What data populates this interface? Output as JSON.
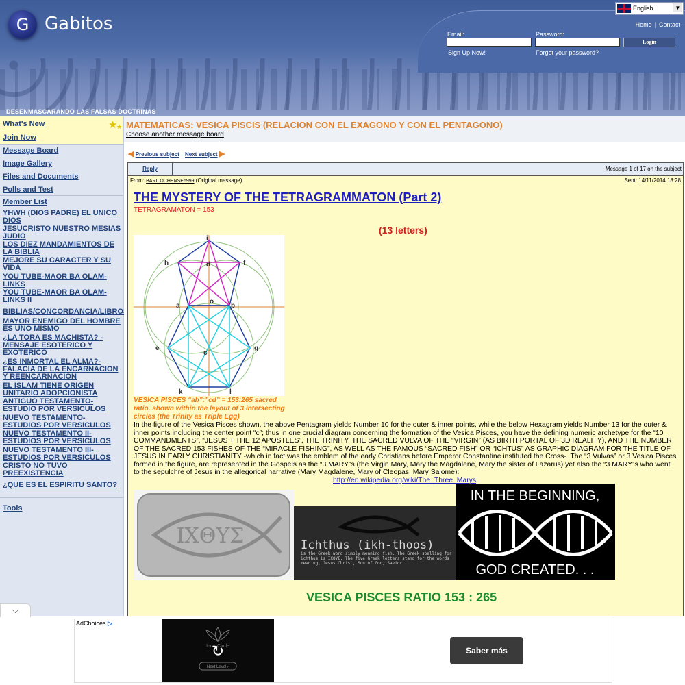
{
  "header": {
    "site_name": "Gabitos",
    "logo_letter": "G",
    "language": "English",
    "links": {
      "home": "Home",
      "contact": "Contact"
    },
    "email_label": "Email:",
    "password_label": "Password:",
    "login_button": "Login",
    "signup": "Sign Up Now!",
    "forgot": "Forgot your password?",
    "group_name": "DESENMASCARANDO LAS FALSAS DOCTRINAS"
  },
  "sidebar": {
    "whats_new": "What's New",
    "join_now": "Join Now",
    "message_board": "Message Board",
    "image_gallery": "Image Gallery",
    "files_documents": "Files and Documents",
    "polls_test": "Polls and Test",
    "member_list": "Member List",
    "items": [
      "YHWH (DIOS PADRE) EL UNICO DIOS",
      "JESUCRISTO NUESTRO MESIAS JUDIO",
      "LOS DIEZ MANDAMIENTOS DE LA BIBLIA",
      "MEJORE SU CARACTER Y SU VIDA",
      "YOU TUBE-MAOR BA OLAM-LINKS",
      "YOU TUBE-MAOR BA OLAM-LINKS II",
      "BIBLIAS/CONCORDANCIA/LIBROS",
      "MAYOR ENEMIGO DEL HOMBRE ES UNO MISMO",
      "¿LA TORA ES MACHISTA? -MENSAJE ESOTERICO Y EXOTERICO",
      "¿ES INMORTAL EL ALMA?-FALACIA DE LA ENCARNACION Y REENCARNACION",
      "EL ISLAM TIENE ORIGEN UNITARIO ADOPCIONISTA",
      "ANTIGUO TESTAMENTO-ESTUDIO POR VERSICULOS",
      "NUEVO TESTAMENTO-ESTUDIOS POR VERSICULOS",
      "NUEVO TESTAMENTO II-ESTUDIOS POR VERSICULOS",
      "NUEVO TESTAMENTO III-ESTUDIOS POR VERSICULOS",
      "CRISTO NO TUVO PREEXISTENCIA",
      "¿QUE ES EL ESPIRITU SANTO?"
    ],
    "tools": "Tools"
  },
  "main": {
    "category": "MATEMATICAS:",
    "subject": "VESICA PISCIS (RELACION CON EL EXAGONO Y CON EL PENTAGONO)",
    "choose_board": "Choose another message board",
    "prev_subject": "Previous subject",
    "next_subject": "Next subject",
    "reply": "Reply",
    "message_count": "Message 1 of 17 on the subject",
    "from_label": "From:",
    "from_user": "BARILOCHENSE6999",
    "from_note": "(Original message)",
    "sent": "Sent: 14/11/2014 18:28"
  },
  "post": {
    "title": "THE MYSTERY OF THE TETRAGRAMMATON (Part 2)",
    "subtitle": "TETRAGRAMATON  =  153",
    "letters": "(13 letters)",
    "diagram_labels": {
      "i": "i",
      "h": "h",
      "d": "d",
      "f": "f",
      "a": "a",
      "o": "o",
      "b": "b",
      "e": "e",
      "c": "c",
      "g": "g",
      "k": "k",
      "l": "l"
    },
    "caption": "VESICA PISCES “ab”:”cd” = 153:265 sacred ratio, shown within the layout of 3 intersecting circles (the Trinity as Triple Egg)",
    "body": "In the figure of the Vesica Pisces shown, the above Pentagram yields Number 10 for the outer & inner points, while the below Hexagram yields Number 13 for the outer & inner points including the center point “c”; thus in one crucial diagram concerning the formation of the Vesica Pisces, you have the defining numeric archetype for the “10 COMMANDMENTS”, “JESUS + THE 12 APOSTLES”, THE TRINITY, THE SACRED VULVA OF THE “VIRGIN” (AS BIRTH PORTAL OF 3D REALITY), AND THE NUMBER OF THE SACRED 153 FISHES OF THE “MIRACLE FISHING”, AS WELL AS THE FAMOUS “SACRED FISH” OR “ICHTUS” AS GRAPHIC DIAGRAM FOR THE TITLE OF JESUS IN EARLY CHRISTIANITY -which in fact was the emblem of the early Christians before Emperor Constantine instituted the Cross-.  The “3 Vulvas” or 3 Vesica Pisces formed in the figure, are represented in the Gospels as the “3 MARY”s (the Virgin Mary, Mary the Magdalene, Mary the sister of Lazarus) yet also the “3 MARY”s who went to the sepulchre of Jesus in the allegorical narrative (Mary Magdalene, Mary of Cleopas, Mary Salome):",
    "link": "http://en.wikipedia.org/wiki/The_Three_Marys",
    "img1_text": "ΙΧΘΥΣ",
    "img2_title": "Ichthus (ikh-thoos)",
    "img2_text": "is the Greek word simply meaning fish. The Greek spelling for ichthus is IXΘYΣ. The five Greek letters stand for the words meaning, Jesus Christ, Son of God, Savior.",
    "img3_top": "IN THE BEGINNING,",
    "img3_bottom": "GOD CREATED. . .",
    "ratio_heading": "VESICA PISCES RATIO 153 : 265"
  },
  "ad": {
    "adchoices": "AdChoices",
    "button": "Saber más",
    "img_text_1": "InnerCircle",
    "img_text_2": "Next Level ›"
  },
  "colors": {
    "header_blue": "#4e6ca8",
    "link_blue": "#20427e",
    "category_orange": "#e0822d",
    "post_bg": "#fffbc7",
    "title_blue": "#1f1fbf",
    "ratio_green": "#1a8a2e"
  }
}
